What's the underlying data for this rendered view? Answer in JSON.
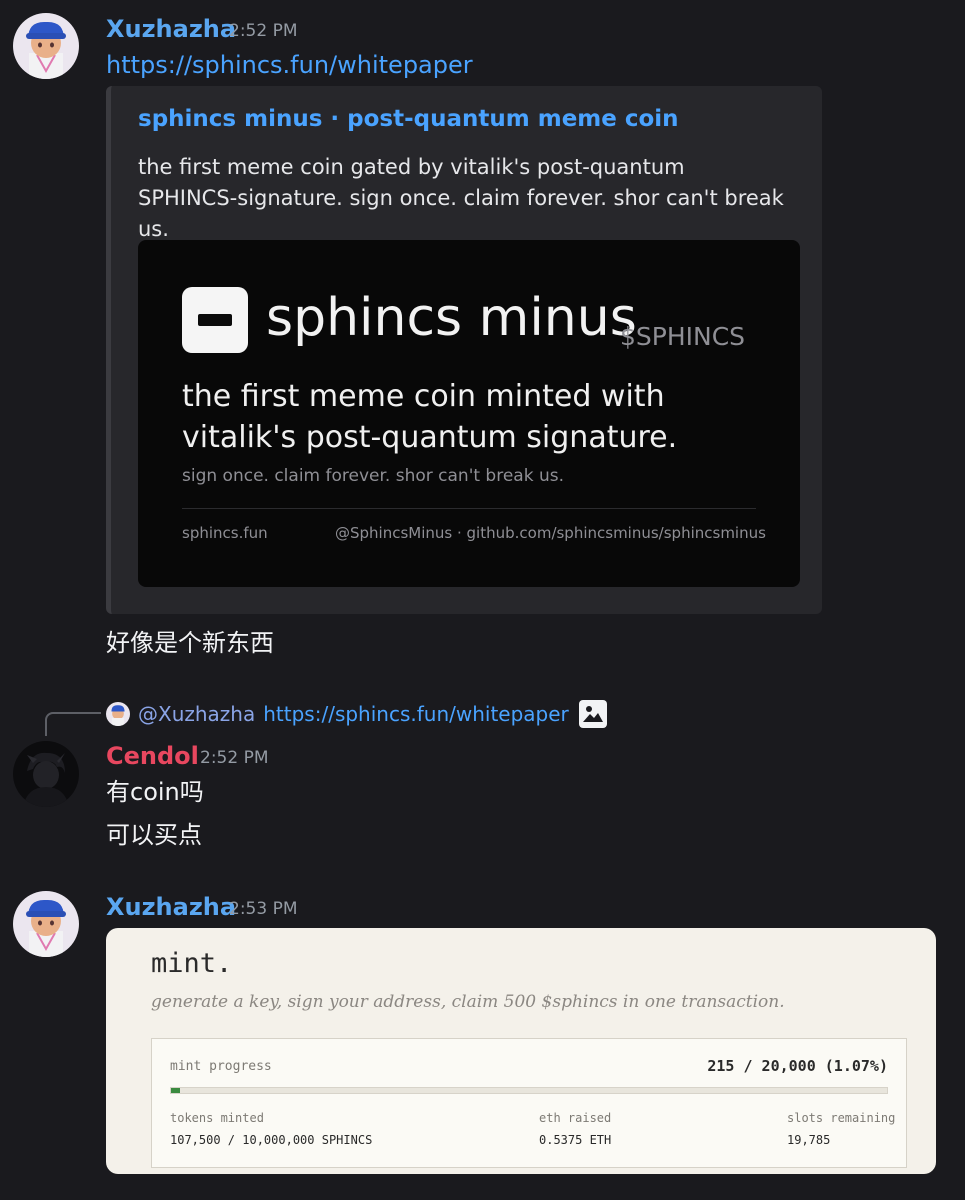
{
  "messages": [
    {
      "username": "Xuzhazha",
      "timestamp": "2:52 PM",
      "link": "https://sphincs.fun/whitepaper",
      "embed": {
        "title": "sphincs minus · post-quantum meme coin",
        "description": "the first meme coin gated by vitalik's post-quantum SPHINCS-signature. sign once. claim forever. shor can't break us.",
        "image": {
          "brand": "sphincs minus",
          "ticker": "$SPHINCS",
          "headline": "the first meme coin minted with vitalik's post-quantum signature.",
          "tagline": "sign once. claim forever.  shor can't break us.",
          "footer_left": "sphincs.fun",
          "footer_right": "@SphincsMinus · github.com/sphincsminus/sphincsminus"
        }
      },
      "text": "好像是个新东西"
    },
    {
      "reply_to": {
        "mention": "@Xuzhazha",
        "link": "https://sphincs.fun/whitepaper"
      },
      "username": "Cendol",
      "timestamp": "2:52 PM",
      "lines": [
        "有coin吗",
        "可以买点"
      ]
    },
    {
      "username": "Xuzhazha",
      "timestamp": "2:53 PM",
      "mint_card": {
        "title": "mint.",
        "subtitle": "generate a key, sign your address, claim 500 $sphincs in one transaction.",
        "progress_label": "mint progress",
        "progress_text": "215 / 20,000 (1.07%)",
        "progress_fraction": 0.0107,
        "stats": [
          {
            "label": "tokens minted",
            "value": "107,500 / 10,000,000 SPHINCS"
          },
          {
            "label": "eth raised",
            "value": "0.5375 ETH"
          },
          {
            "label": "slots remaining",
            "value": "19,785"
          }
        ]
      }
    }
  ],
  "colors": {
    "background": "#1a1a1e",
    "xuzhazha_name": "#5aa6f0",
    "cendol_name": "#e8475f",
    "link": "#4aa3ff",
    "progress_fill": "#3a8a3f"
  },
  "icons": [
    "image-icon"
  ]
}
